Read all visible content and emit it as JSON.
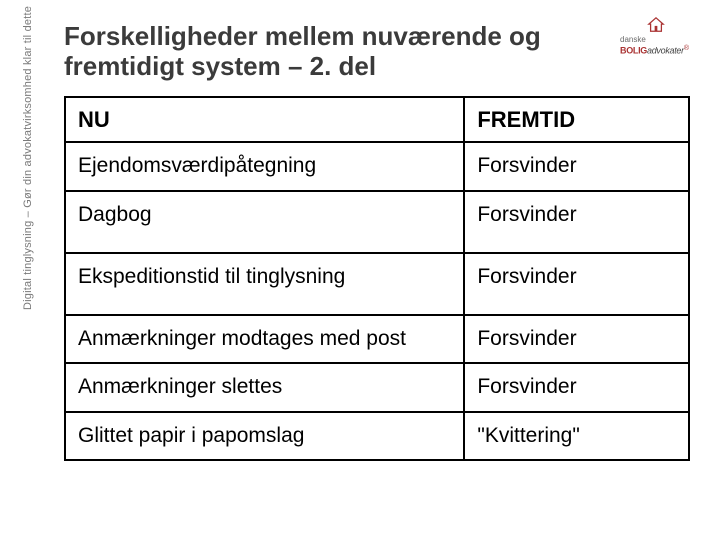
{
  "sidebar_text": "Digital tinglysning – Gør din advokatvirksomhed klar til dette",
  "logo": {
    "line1": "danske",
    "line2_strong": "BOLIG",
    "line2_em": "advokater"
  },
  "title": "Forskelligheder mellem nuværende og fremtidigt system – 2. del",
  "chart_data": {
    "type": "table",
    "title": "Forskelligheder mellem nuværende og fremtidigt system – 2. del",
    "columns": [
      "NU",
      "FREMTID"
    ],
    "rows": [
      [
        "Ejendomsværdipåtegning",
        "Forsvinder"
      ],
      [
        "Dagbog",
        "Forsvinder"
      ],
      [
        "Ekspeditionstid til tinglysning",
        "Forsvinder"
      ],
      [
        "Anmærkninger modtages med post",
        "Forsvinder"
      ],
      [
        "Anmærkninger slettes",
        "Forsvinder"
      ],
      [
        "Glittet papir i papomslag",
        "\"Kvittering\""
      ]
    ]
  }
}
